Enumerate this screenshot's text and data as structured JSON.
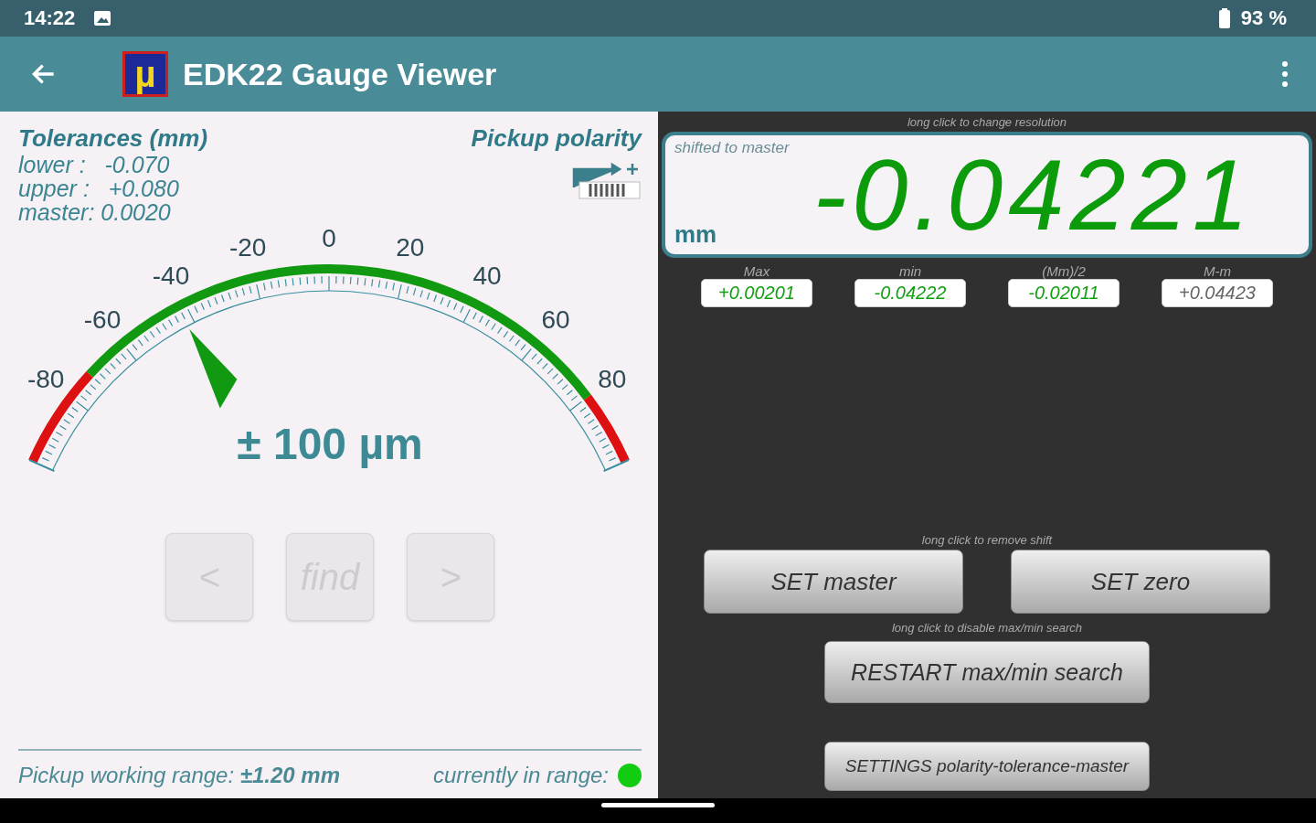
{
  "status_bar": {
    "time": "14:22",
    "battery": "93 %"
  },
  "app_bar": {
    "logo_glyph": "µ",
    "title": "EDK22 Gauge Viewer"
  },
  "tolerances": {
    "title": "Tolerances (mm)",
    "lines": [
      "lower :   -0.070",
      "upper :   +0.080",
      "master: 0.0020"
    ]
  },
  "pickup_polarity": {
    "label": "Pickup polarity"
  },
  "gauge": {
    "scale_labels": [
      "-80",
      "-60",
      "-40",
      "-20",
      "0",
      "20",
      "40",
      "60",
      "80"
    ],
    "level": 0.289,
    "range": "± 100 µm"
  },
  "nav_buttons": [
    {
      "label": "<",
      "disabled": true
    },
    {
      "label": "find",
      "disabled": true
    },
    {
      "label": ">",
      "disabled": true
    }
  ],
  "footer": {
    "range_text": "Pickup working range: **±1.20 mm**",
    "in_range_label": "currently in range:",
    "in_range": true
  },
  "display": {
    "hint": "long click to change resolution",
    "mode": "shifted to master",
    "unit": "mm",
    "value": "-0.04221"
  },
  "stats": [
    {
      "label": "Max",
      "value": "+0.00201",
      "color": "#11a011"
    },
    {
      "label": "min",
      "value": "-0.04222",
      "color": "#11a011"
    },
    {
      "label": "(Mm)/2",
      "value": "-0.02011",
      "color": "#11a011"
    },
    {
      "label": "M-m",
      "value": "+0.04423",
      "color": "#666666"
    }
  ],
  "hint_shift": "long click to remove shift",
  "buttons": {
    "set_master": "SET master",
    "set_zero": "SET zero"
  },
  "hint_search": "long click to disable max/min search",
  "restart": "RESTART max/min search",
  "settings": "SETTINGS polarity-tolerance-master"
}
